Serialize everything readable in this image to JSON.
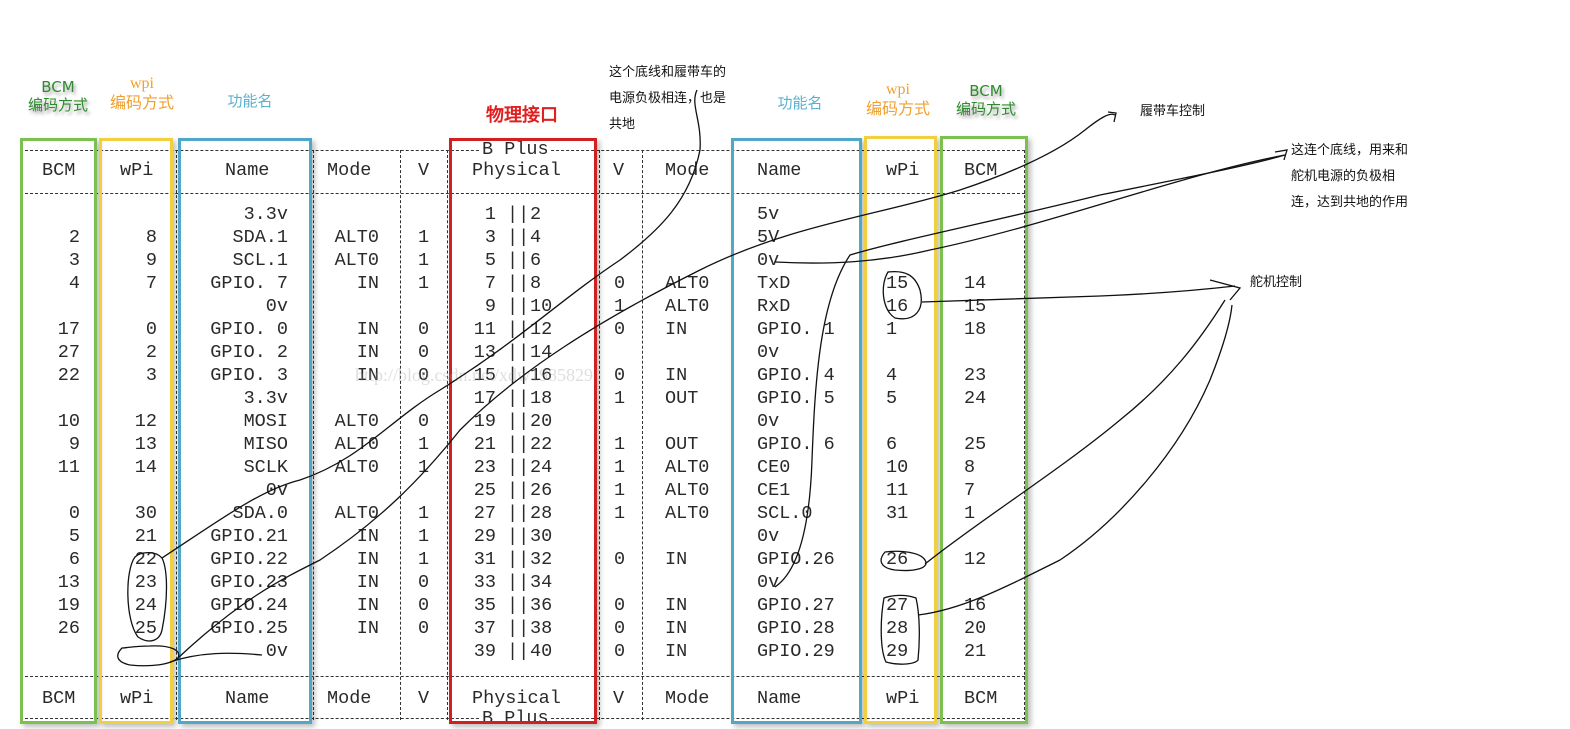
{
  "labels": {
    "bcm_left": {
      "title": "BCM",
      "sub": "编码方式",
      "color": "#2e8b2e"
    },
    "wpi_left": {
      "title": "wpi",
      "sub": "编码方式",
      "color": "#f0a030"
    },
    "name_left": {
      "title": "功能名",
      "color": "#5ab0d0"
    },
    "physical": {
      "title": "物理接口",
      "color": "#e02020"
    },
    "name_right": {
      "title": "功能名",
      "color": "#5ab0d0"
    },
    "wpi_right": {
      "title": "wpi",
      "sub": "编码方式",
      "color": "#f0a030"
    },
    "bcm_right": {
      "title": "BCM",
      "sub": "编码方式",
      "color": "#2e8b2e"
    }
  },
  "notes": {
    "ground_track": [
      "这个底线和履带车的",
      "电源负极相连，也是",
      "共地"
    ],
    "track_control": "履带车控制",
    "ground_servo": [
      "这连个底线，用来和",
      "舵机电源的负极相",
      "连，达到共地的作用"
    ],
    "servo_control": "舵机控制"
  },
  "header": {
    "board": "B Plus",
    "cols": [
      "BCM",
      "wPi",
      "Name",
      "Mode",
      "V",
      "Physical",
      "V",
      "Mode",
      "Name",
      "wPi",
      "BCM"
    ]
  },
  "rows": [
    {
      "bcmL": "",
      "wpiL": "",
      "nameL": "3.3v",
      "modeL": "",
      "vL": "",
      "pL": "1",
      "pR": "2",
      "vR": "",
      "modeR": "",
      "nameR": "5v",
      "wpiR": "",
      "bcmR": ""
    },
    {
      "bcmL": "2",
      "wpiL": "8",
      "nameL": "SDA.1",
      "modeL": "ALT0",
      "vL": "1",
      "pL": "3",
      "pR": "4",
      "vR": "",
      "modeR": "",
      "nameR": "5V",
      "wpiR": "",
      "bcmR": ""
    },
    {
      "bcmL": "3",
      "wpiL": "9",
      "nameL": "SCL.1",
      "modeL": "ALT0",
      "vL": "1",
      "pL": "5",
      "pR": "6",
      "vR": "",
      "modeR": "",
      "nameR": "0v",
      "wpiR": "",
      "bcmR": ""
    },
    {
      "bcmL": "4",
      "wpiL": "7",
      "nameL": "GPIO. 7",
      "modeL": "IN",
      "vL": "1",
      "pL": "7",
      "pR": "8",
      "vR": "0",
      "modeR": "ALT0",
      "nameR": "TxD",
      "wpiR": "15",
      "bcmR": "14"
    },
    {
      "bcmL": "",
      "wpiL": "",
      "nameL": "0v",
      "modeL": "",
      "vL": "",
      "pL": "9",
      "pR": "10",
      "vR": "1",
      "modeR": "ALT0",
      "nameR": "RxD",
      "wpiR": "16",
      "bcmR": "15"
    },
    {
      "bcmL": "17",
      "wpiL": "0",
      "nameL": "GPIO. 0",
      "modeL": "IN",
      "vL": "0",
      "pL": "11",
      "pR": "12",
      "vR": "0",
      "modeR": "IN",
      "nameR": "GPIO. 1",
      "wpiR": "1",
      "bcmR": "18"
    },
    {
      "bcmL": "27",
      "wpiL": "2",
      "nameL": "GPIO. 2",
      "modeL": "IN",
      "vL": "0",
      "pL": "13",
      "pR": "14",
      "vR": "",
      "modeR": "",
      "nameR": "0v",
      "wpiR": "",
      "bcmR": ""
    },
    {
      "bcmL": "22",
      "wpiL": "3",
      "nameL": "GPIO. 3",
      "modeL": "IN",
      "vL": "0",
      "pL": "15",
      "pR": "16",
      "vR": "0",
      "modeR": "IN",
      "nameR": "GPIO. 4",
      "wpiR": "4",
      "bcmR": "23"
    },
    {
      "bcmL": "",
      "wpiL": "",
      "nameL": "3.3v",
      "modeL": "",
      "vL": "",
      "pL": "17",
      "pR": "18",
      "vR": "1",
      "modeR": "OUT",
      "nameR": "GPIO. 5",
      "wpiR": "5",
      "bcmR": "24"
    },
    {
      "bcmL": "10",
      "wpiL": "12",
      "nameL": "MOSI",
      "modeL": "ALT0",
      "vL": "0",
      "pL": "19",
      "pR": "20",
      "vR": "",
      "modeR": "",
      "nameR": "0v",
      "wpiR": "",
      "bcmR": ""
    },
    {
      "bcmL": "9",
      "wpiL": "13",
      "nameL": "MISO",
      "modeL": "ALT0",
      "vL": "1",
      "pL": "21",
      "pR": "22",
      "vR": "1",
      "modeR": "OUT",
      "nameR": "GPIO. 6",
      "wpiR": "6",
      "bcmR": "25"
    },
    {
      "bcmL": "11",
      "wpiL": "14",
      "nameL": "SCLK",
      "modeL": "ALT0",
      "vL": "1",
      "pL": "23",
      "pR": "24",
      "vR": "1",
      "modeR": "ALT0",
      "nameR": "CE0",
      "wpiR": "10",
      "bcmR": "8"
    },
    {
      "bcmL": "",
      "wpiL": "",
      "nameL": "0v",
      "modeL": "",
      "vL": "",
      "pL": "25",
      "pR": "26",
      "vR": "1",
      "modeR": "ALT0",
      "nameR": "CE1",
      "wpiR": "11",
      "bcmR": "7"
    },
    {
      "bcmL": "0",
      "wpiL": "30",
      "nameL": "SDA.0",
      "modeL": "ALT0",
      "vL": "1",
      "pL": "27",
      "pR": "28",
      "vR": "1",
      "modeR": "ALT0",
      "nameR": "SCL.0",
      "wpiR": "31",
      "bcmR": "1"
    },
    {
      "bcmL": "5",
      "wpiL": "21",
      "nameL": "GPIO.21",
      "modeL": "IN",
      "vL": "1",
      "pL": "29",
      "pR": "30",
      "vR": "",
      "modeR": "",
      "nameR": "0v",
      "wpiR": "",
      "bcmR": ""
    },
    {
      "bcmL": "6",
      "wpiL": "22",
      "nameL": "GPIO.22",
      "modeL": "IN",
      "vL": "1",
      "pL": "31",
      "pR": "32",
      "vR": "0",
      "modeR": "IN",
      "nameR": "GPIO.26",
      "wpiR": "26",
      "bcmR": "12"
    },
    {
      "bcmL": "13",
      "wpiL": "23",
      "nameL": "GPIO.23",
      "modeL": "IN",
      "vL": "0",
      "pL": "33",
      "pR": "34",
      "vR": "",
      "modeR": "",
      "nameR": "0v",
      "wpiR": "",
      "bcmR": ""
    },
    {
      "bcmL": "19",
      "wpiL": "24",
      "nameL": "GPIO.24",
      "modeL": "IN",
      "vL": "0",
      "pL": "35",
      "pR": "36",
      "vR": "0",
      "modeR": "IN",
      "nameR": "GPIO.27",
      "wpiR": "27",
      "bcmR": "16"
    },
    {
      "bcmL": "26",
      "wpiL": "25",
      "nameL": "GPIO.25",
      "modeL": "IN",
      "vL": "0",
      "pL": "37",
      "pR": "38",
      "vR": "0",
      "modeR": "IN",
      "nameR": "GPIO.28",
      "wpiR": "28",
      "bcmR": "20"
    },
    {
      "bcmL": "",
      "wpiL": "",
      "nameL": "0v",
      "modeL": "",
      "vL": "",
      "pL": "39",
      "pR": "40",
      "vR": "0",
      "modeR": "IN",
      "nameR": "GPIO.29",
      "wpiR": "29",
      "bcmR": "21"
    }
  ],
  "watermark": "http://blog.csdn.net/xdw1985829"
}
